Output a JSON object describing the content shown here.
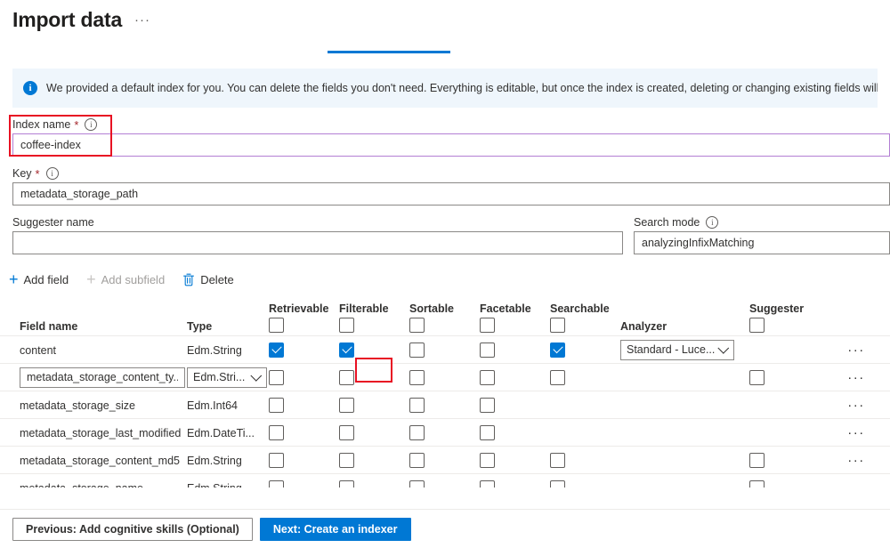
{
  "header": {
    "title": "Import data",
    "ellipsis": "···",
    "tab_accent": "#0078d4"
  },
  "banner": {
    "icon": "info-icon",
    "text": "We provided a default index for you. You can delete the fields you don't need. Everything is editable, but once the index is created, deleting or changing existing fields will require re-indexing",
    "background": "#eff6fc",
    "icon_color": "#0078d4"
  },
  "form": {
    "index_name": {
      "label": "Index name",
      "required": "*",
      "info": "ⓘ",
      "value": "coffee-index",
      "placeholder": "",
      "focus_border": "#b37fd4",
      "annotation_color": "#e81123"
    },
    "key": {
      "label": "Key",
      "required": "*",
      "info": "ⓘ",
      "value": "metadata_storage_path",
      "placeholder": ""
    },
    "suggester_name": {
      "label": "Suggester name",
      "value": "",
      "placeholder": ""
    },
    "search_mode": {
      "label": "Search mode",
      "info": "ⓘ",
      "value": "analyzingInfixMatching",
      "placeholder": ""
    }
  },
  "commandbar": {
    "add_field": "Add field",
    "add_subfield": "Add subfield",
    "delete": "Delete",
    "accent": "#0078d4",
    "disabled_color": "#a19f9d"
  },
  "table": {
    "columns": {
      "field_name": "Field name",
      "type": "Type",
      "retrievable": "Retrievable",
      "filterable": "Filterable",
      "sortable": "Sortable",
      "facetable": "Facetable",
      "searchable": "Searchable",
      "analyzer": "Analyzer",
      "suggester": "Suggester"
    },
    "header_checkboxes": {
      "retrievable": false,
      "filterable": false,
      "sortable": false,
      "facetable": false,
      "searchable": false,
      "suggester": false
    },
    "rows": [
      {
        "name": "content",
        "name_editable": false,
        "type": "Edm.String",
        "type_editable": false,
        "retrievable": true,
        "filterable": true,
        "sortable": false,
        "facetable": false,
        "searchable": true,
        "searchable_present": true,
        "analyzer": "Standard - Luce...",
        "analyzer_present": true,
        "suggester": false,
        "suggester_present": false,
        "menu": "···"
      },
      {
        "name": "metadata_storage_content_ty...",
        "name_editable": true,
        "type": "Edm.Stri...",
        "type_editable": true,
        "retrievable": false,
        "filterable": false,
        "sortable": false,
        "facetable": false,
        "searchable": false,
        "searchable_present": true,
        "analyzer": "",
        "analyzer_present": false,
        "suggester": false,
        "suggester_present": true,
        "menu": "···"
      },
      {
        "name": "metadata_storage_size",
        "name_editable": false,
        "type": "Edm.Int64",
        "type_editable": false,
        "retrievable": false,
        "filterable": false,
        "sortable": false,
        "facetable": false,
        "searchable": false,
        "searchable_present": false,
        "analyzer": "",
        "analyzer_present": false,
        "suggester": false,
        "suggester_present": false,
        "menu": "···"
      },
      {
        "name": "metadata_storage_last_modified",
        "name_editable": false,
        "type": "Edm.DateTi...",
        "type_editable": false,
        "retrievable": false,
        "filterable": false,
        "sortable": false,
        "facetable": false,
        "searchable": false,
        "searchable_present": false,
        "analyzer": "",
        "analyzer_present": false,
        "suggester": false,
        "suggester_present": false,
        "menu": "···"
      },
      {
        "name": "metadata_storage_content_md5",
        "name_editable": false,
        "type": "Edm.String",
        "type_editable": false,
        "retrievable": false,
        "filterable": false,
        "sortable": false,
        "facetable": false,
        "searchable": false,
        "searchable_present": true,
        "analyzer": "",
        "analyzer_present": false,
        "suggester": false,
        "suggester_present": true,
        "menu": "···"
      },
      {
        "name": "metadata_storage_name",
        "name_editable": false,
        "type": "Edm.String",
        "type_editable": false,
        "retrievable": false,
        "filterable": false,
        "sortable": false,
        "facetable": false,
        "searchable": false,
        "searchable_present": true,
        "analyzer": "",
        "analyzer_present": false,
        "suggester": false,
        "suggester_present": true,
        "menu": "···"
      }
    ]
  },
  "footer": {
    "previous": "Previous: Add cognitive skills (Optional)",
    "next": "Next: Create an indexer",
    "primary_color": "#0078d4"
  }
}
